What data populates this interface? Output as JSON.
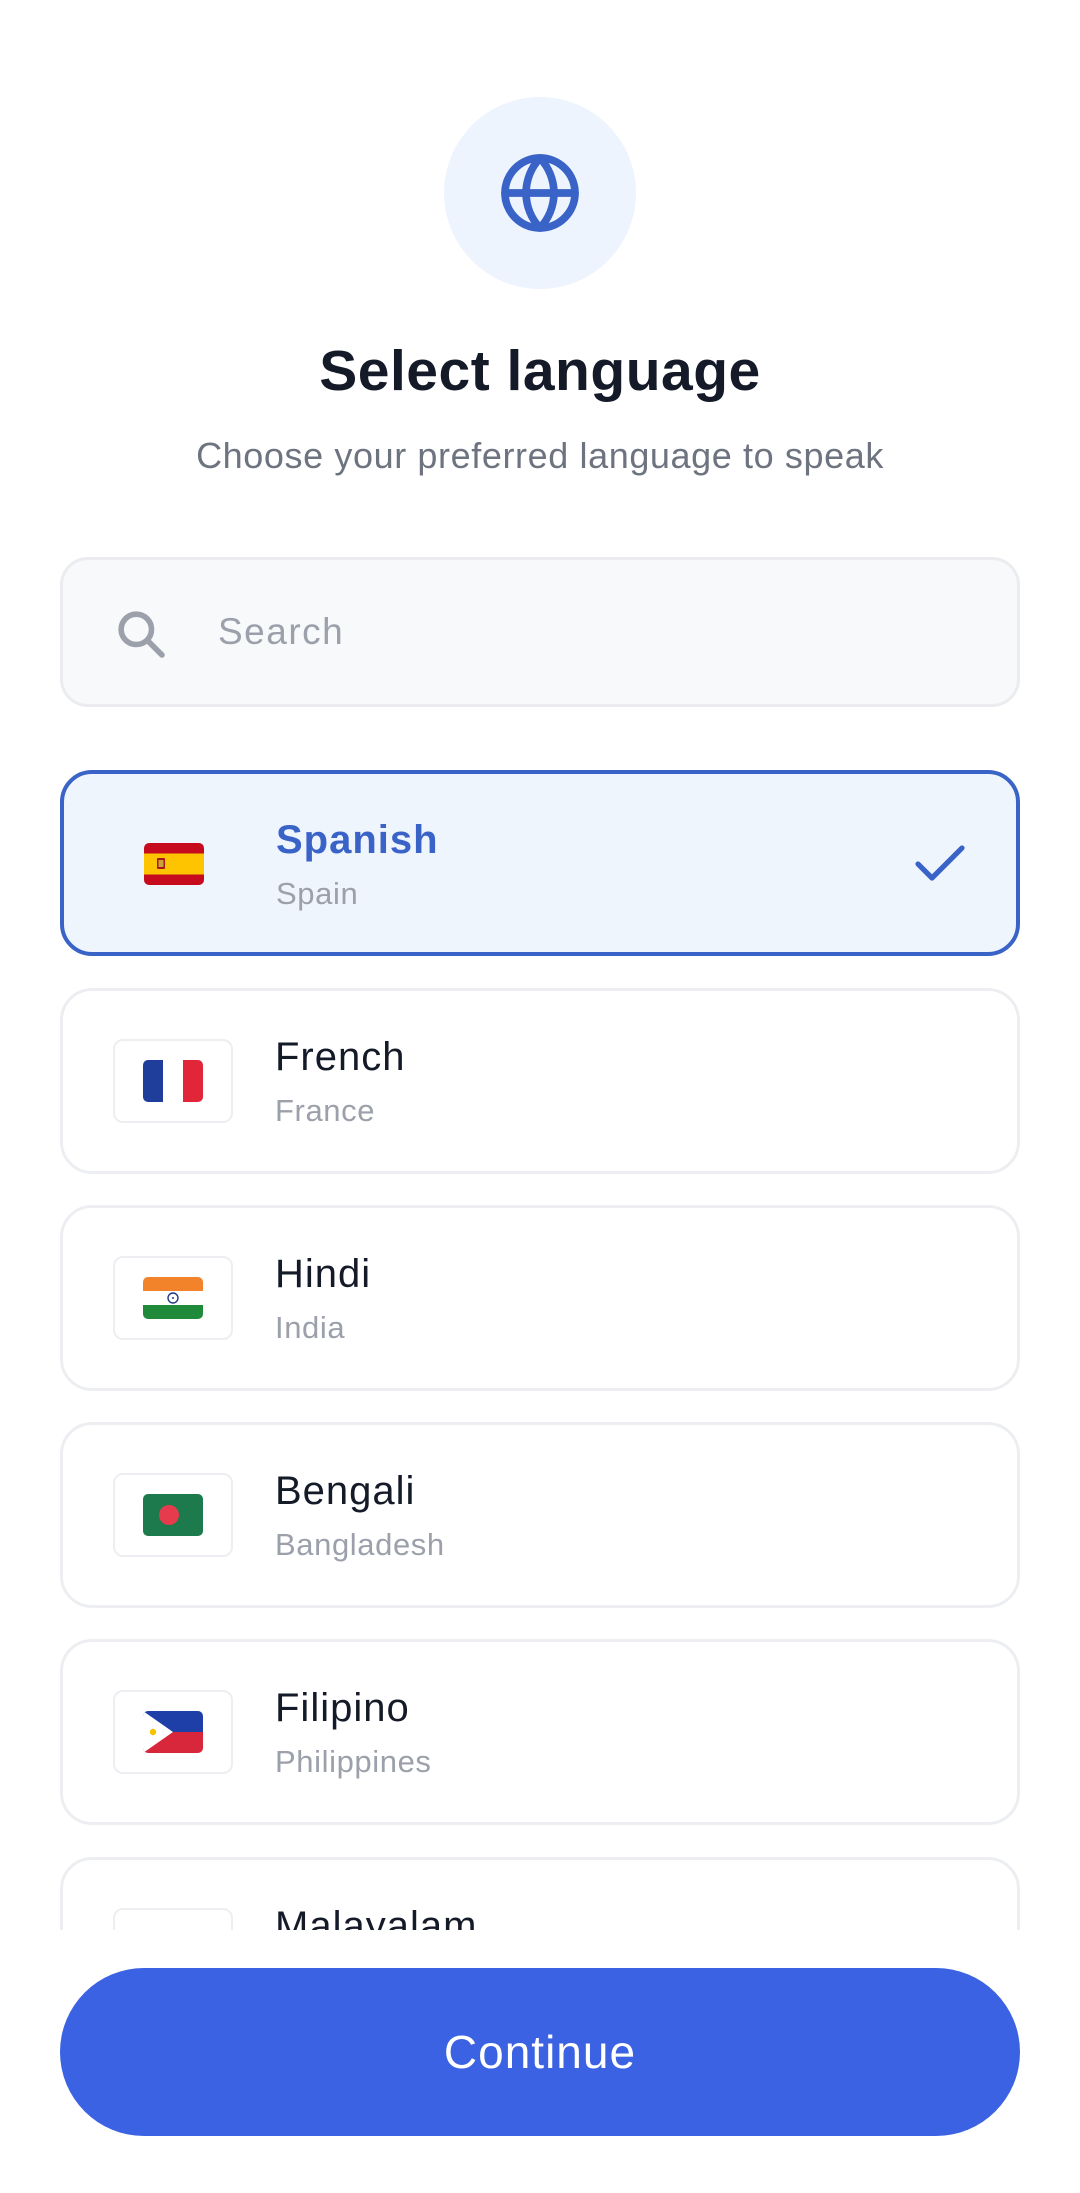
{
  "header": {
    "icon": "globe-icon",
    "title": "Select language",
    "subtitle": "Choose your preferred language to speak"
  },
  "search": {
    "icon": "search-icon",
    "placeholder": "Search",
    "value": ""
  },
  "languages": [
    {
      "name": "Spanish",
      "country": "Spain",
      "flag": "spain-flag",
      "selected": true
    },
    {
      "name": "French",
      "country": "France",
      "flag": "france-flag",
      "selected": false
    },
    {
      "name": "Hindi",
      "country": "India",
      "flag": "india-flag",
      "selected": false
    },
    {
      "name": "Bengali",
      "country": "Bangladesh",
      "flag": "bangladesh-flag",
      "selected": false
    },
    {
      "name": "Filipino",
      "country": "Philippines",
      "flag": "philippines-flag",
      "selected": false
    },
    {
      "name": "Malayalam",
      "country": "",
      "flag": "",
      "selected": false
    }
  ],
  "colors": {
    "accent": "#3a63c8",
    "button": "#3a62e2",
    "selected_bg": "#eff5fd",
    "title": "#141a28",
    "muted": "#9ba0ab"
  },
  "actions": {
    "continue_label": "Continue"
  }
}
